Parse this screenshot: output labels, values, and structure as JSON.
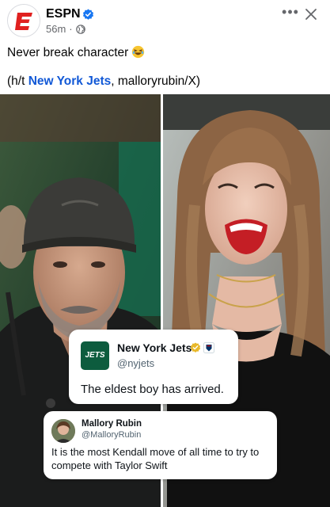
{
  "post": {
    "page_name": "ESPN",
    "time": "56m",
    "separator": "·",
    "text": "Never break character",
    "credit_prefix": "(h/t ",
    "credit_link": "New York Jets",
    "credit_suffix": ", malloryrubin/X)"
  },
  "icons": {
    "more": "more-options-icon",
    "close": "close-icon",
    "verified": "verified-badge-icon",
    "audience": "globe-icon",
    "emoji": "laughing-emoji-icon"
  },
  "tweet_jets": {
    "logo_text": "JETS",
    "name": "New York Jets",
    "handle": "@nyjets",
    "text": "The eldest boy has arrived."
  },
  "tweet_mallory": {
    "name": "Mallory Rubin",
    "handle": "@MalloryRubin",
    "text": "It is the most Kendall move of all time to try to compete with Taylor Swift"
  },
  "colors": {
    "brand_red": "#e0201f",
    "link_blue": "#1158d6",
    "verified_blue": "#1877f2",
    "jets_green": "#0d5c3e",
    "gold_check": "#e8b829"
  }
}
